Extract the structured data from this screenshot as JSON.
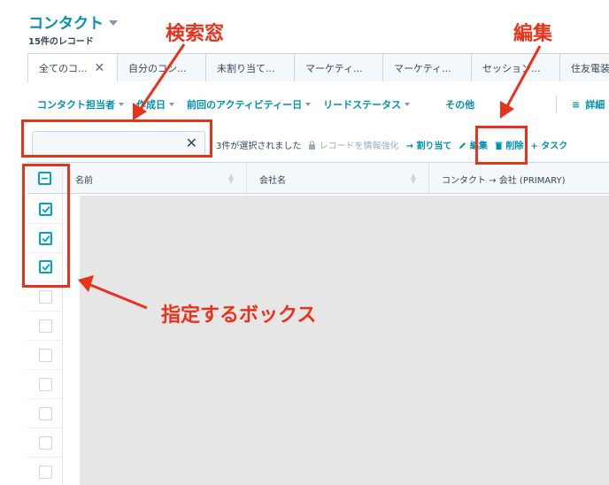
{
  "header": {
    "title": "コンタクト",
    "record_count": "15件のレコード"
  },
  "tabs": [
    {
      "label": "全てのコ...",
      "active": true,
      "close": "✕"
    },
    {
      "label": "自分のコン..."
    },
    {
      "label": "未割り当て..."
    },
    {
      "label": "マーケティ..."
    },
    {
      "label": "マーケティ..."
    },
    {
      "label": "セッション..."
    },
    {
      "label": "住友電装"
    }
  ],
  "filters": [
    {
      "label": "コンタクト担当者"
    },
    {
      "label": "作成日"
    },
    {
      "label": "前回のアクティビティー日"
    },
    {
      "label": "リードステータス"
    }
  ],
  "toolbar": {
    "more_label": "その他",
    "detail_icon": "≡",
    "detail_label": "詳細"
  },
  "search": {
    "value": "",
    "placeholder": "",
    "clear": "✕"
  },
  "bulk": {
    "selected_text": "3件が選択されました",
    "enrich_label": "レコードを情報強化",
    "assign_label": "割り当て",
    "edit_label": "編集",
    "delete_label": "削除",
    "task_label": "タスク"
  },
  "table": {
    "columns": [
      {
        "label": "名前"
      },
      {
        "label": "会社名"
      },
      {
        "label": "コンタクト → 会社 (PRIMARY)"
      }
    ],
    "rows": [
      {
        "checked": true
      },
      {
        "checked": true
      },
      {
        "checked": true
      },
      {
        "checked": false
      },
      {
        "checked": false
      },
      {
        "checked": false
      },
      {
        "checked": false
      },
      {
        "checked": false
      },
      {
        "checked": false
      },
      {
        "checked": false
      }
    ]
  },
  "annotations": {
    "search_window": "検索窓",
    "edit": "編集",
    "boxes": "指定するボックス"
  },
  "colors": {
    "accent": "#0091ae",
    "annotation_red": "#e8331c",
    "checkbox": "#00a4bd"
  }
}
